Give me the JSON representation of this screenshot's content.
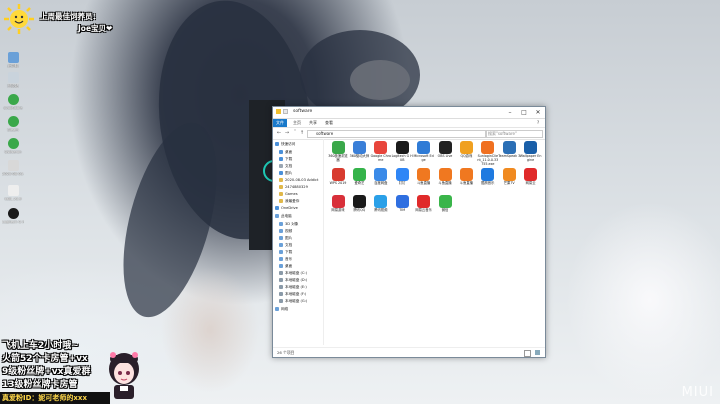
{
  "overlay": {
    "top_line1": "上周最佳饲养员：",
    "top_line2": "Joe宝贝❤",
    "lines": [
      "飞机上车2小时哦~",
      "火箭52个卡房管+vx",
      "9级粉丝牌+vx真爱群",
      "13级粉丝牌卡房管"
    ],
    "banner": "真爱粉ID：妮可老师的xxx",
    "watermark": "MIUI"
  },
  "desktop_icons": [
    {
      "label": "此电脑",
      "color": "#6aa0d8"
    },
    {
      "label": "回收站",
      "color": "#c9d3dc"
    },
    {
      "label": "ovobubble",
      "color": "#3aa84a"
    },
    {
      "label": "Steam",
      "color": "#3aa84a"
    },
    {
      "label": "Qsbseron",
      "color": "#3aa84a"
    },
    {
      "label": "2020-08-03 Addicho...",
      "color": "#d8d8d8"
    },
    {
      "label": "ksbl_v3.9",
      "color": "#eee"
    },
    {
      "label": "Logitech G HUB",
      "color": "#1a1a1a"
    }
  ],
  "explorer": {
    "title": "software",
    "ribbon_tabs": [
      "文件",
      "主页",
      "共享",
      "查看"
    ],
    "address": "software",
    "search_placeholder": "搜索\"software\"",
    "nav_items": [
      {
        "label": "快速访问",
        "color": "#4a90d9"
      },
      {
        "label": "桌面",
        "color": "#4a90d9"
      },
      {
        "label": "下载",
        "color": "#4a90d9"
      },
      {
        "label": "文档",
        "color": "#9aa6b2"
      },
      {
        "label": "图片",
        "color": "#4a90d9"
      },
      {
        "label": "2020-08-03 Addict",
        "color": "#e0b84a"
      },
      {
        "label": "2474880329",
        "color": "#e0b84a"
      },
      {
        "label": "Games",
        "color": "#e0b84a"
      },
      {
        "label": "我最爱你",
        "color": "#e0b84a"
      },
      {
        "label": "OneDrive",
        "color": "#4a90d9"
      },
      {
        "label": "此电脑",
        "color": "#6aa0d8"
      },
      {
        "label": "3D 对象",
        "color": "#6aa0d8"
      },
      {
        "label": "视频",
        "color": "#6aa0d8"
      },
      {
        "label": "图片",
        "color": "#6aa0d8"
      },
      {
        "label": "文档",
        "color": "#6aa0d8"
      },
      {
        "label": "下载",
        "color": "#6aa0d8"
      },
      {
        "label": "音乐",
        "color": "#6aa0d8"
      },
      {
        "label": "桌面",
        "color": "#6aa0d8"
      },
      {
        "label": "本地磁盘 (C:)",
        "color": "#8a9aa8"
      },
      {
        "label": "本地磁盘 (D:)",
        "color": "#8a9aa8"
      },
      {
        "label": "本地磁盘 (E:)",
        "color": "#8a9aa8"
      },
      {
        "label": "本地磁盘 (F:)",
        "color": "#8a9aa8"
      },
      {
        "label": "本地磁盘 (G:)",
        "color": "#8a9aa8"
      },
      {
        "label": "网络",
        "color": "#6aa0d8"
      }
    ],
    "files": [
      {
        "label": "360极速浏览器",
        "color": "#3aa84a"
      },
      {
        "label": "360驱动大师",
        "color": "#3a7fd8"
      },
      {
        "label": "Google Chrome",
        "color": "#e8453c"
      },
      {
        "label": "Logitech G HUB",
        "color": "#1a1a1a"
      },
      {
        "label": "Microsoft Edge",
        "color": "#2f7bd6"
      },
      {
        "label": "OBS Live",
        "color": "#222"
      },
      {
        "label": "QQ游戏",
        "color": "#f0a020"
      },
      {
        "label": "SunloginClient_11.0.0.33755.exe",
        "color": "#f07020"
      },
      {
        "label": "TeamSpeak 3",
        "color": "#2b6fb5"
      },
      {
        "label": "Wallpaper Engine",
        "color": "#1a5fa8"
      },
      {
        "label": "WPS 2019",
        "color": "#d83b2f"
      },
      {
        "label": "爱奇艺",
        "color": "#35b34a"
      },
      {
        "label": "百度网盘",
        "color": "#3a8ae8"
      },
      {
        "label": "钉钉",
        "color": "#2f86f6"
      },
      {
        "label": "斗鱼直播",
        "color": "#f07820"
      },
      {
        "label": "斗鱼直播",
        "color": "#f07820"
      },
      {
        "label": "斗鱼直播",
        "color": "#f07820"
      },
      {
        "label": "酷狗音乐",
        "color": "#1f7ae0"
      },
      {
        "label": "芒果TV",
        "color": "#f08a20"
      },
      {
        "label": "网易云",
        "color": "#e02a2a"
      },
      {
        "label": "网易游戏",
        "color": "#d8303a"
      },
      {
        "label": "腾讯QQ",
        "color": "#1a1a1a"
      },
      {
        "label": "腾讯视频",
        "color": "#2aa0e8"
      },
      {
        "label": "TIM",
        "color": "#2f6fe0"
      },
      {
        "label": "网易云音乐",
        "color": "#e02a2a"
      },
      {
        "label": "微信",
        "color": "#3ab54a"
      }
    ],
    "status": "26 个项目"
  },
  "colors": {
    "accent": "#1979ca"
  }
}
